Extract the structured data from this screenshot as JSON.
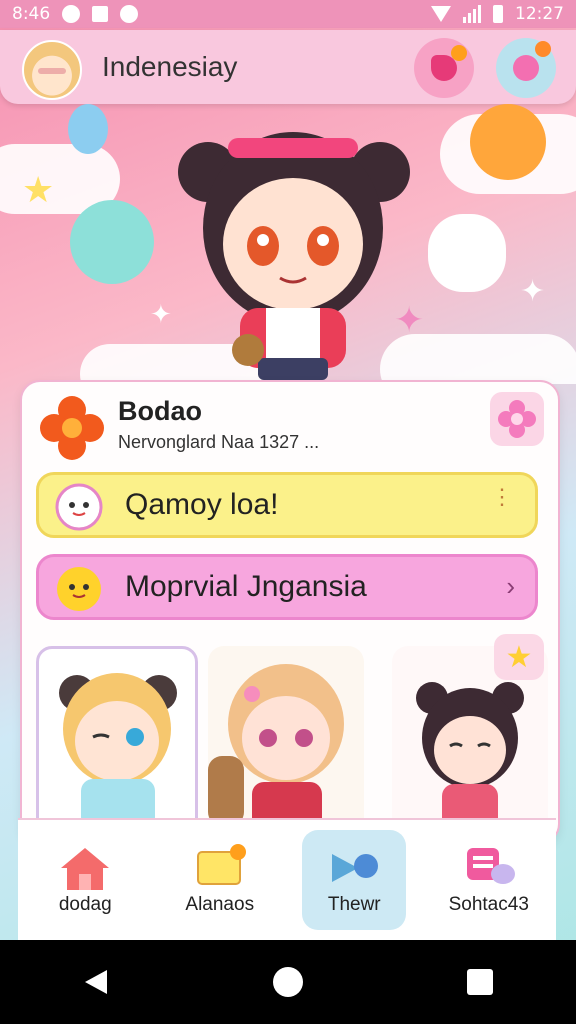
{
  "status_bar": {
    "left_text": "8:46",
    "time": "12:27"
  },
  "header": {
    "title": "Indenesiay"
  },
  "profile": {
    "name": "Bodao",
    "subtitle": "Nervonglard Naa 1327  ..."
  },
  "rows": [
    {
      "label": "Qamoy loa!",
      "color": "#fbf18a"
    },
    {
      "label": "Moprvial Jngansia",
      "color": "#f7a6de"
    }
  ],
  "bottom_nav": [
    {
      "label": "dodag"
    },
    {
      "label": "Alanaos"
    },
    {
      "label": "Thewr"
    },
    {
      "label": "Sohtac43"
    }
  ],
  "colors": {
    "accent_pink": "#f1b4d2",
    "active_tab": "#cde9f4",
    "status_bar": "#ee93b9"
  },
  "icons": [
    "wifi-icon",
    "signal-icon",
    "battery-icon",
    "back-icon",
    "home-icon",
    "recents-icon",
    "star-icon",
    "flower-icon",
    "sun-icon",
    "house-icon",
    "chat-icon",
    "video-icon",
    "message-icon"
  ]
}
